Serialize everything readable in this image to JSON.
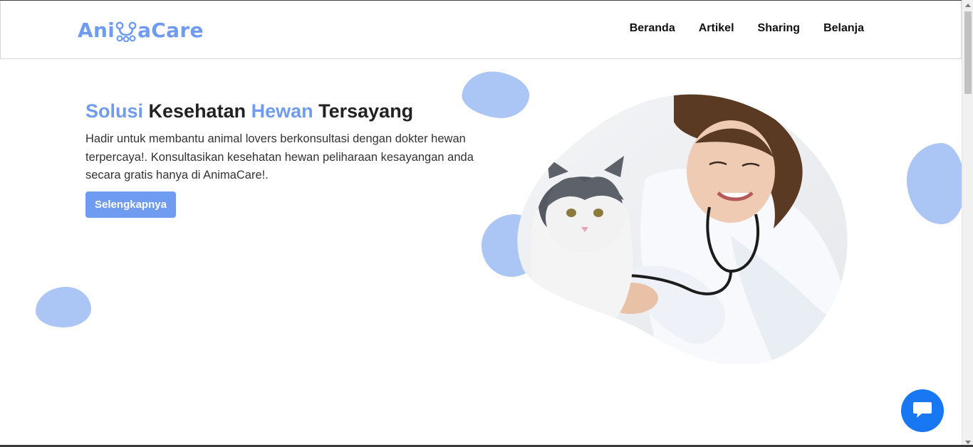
{
  "brand": {
    "name_part1": "Ani",
    "name_part2": "aCare",
    "logo_icon": "paw-icon",
    "color": "#6f9cf0"
  },
  "nav": {
    "items": [
      {
        "label": "Beranda"
      },
      {
        "label": "Artikel"
      },
      {
        "label": "Sharing"
      },
      {
        "label": "Belanja"
      }
    ]
  },
  "hero": {
    "title_word1": "Solusi",
    "title_word2": " Kesehatan ",
    "title_word3": "Hewan",
    "title_word4": " Tersayang",
    "description": "Hadir untuk membantu animal lovers berkonsultasi dengan dokter hewan terpercaya!. Konsultasikan kesehatan hewan peliharaan kesayangan anda secara gratis hanya di AnimaCare!.",
    "cta_label": "Selengkapnya",
    "image_icon": "vet-cat-photo"
  },
  "chat": {
    "icon": "chat-bubble-icon",
    "color": "#1877f2"
  },
  "colors": {
    "accent": "#6f9cf0",
    "blob": "#abc6f5"
  }
}
